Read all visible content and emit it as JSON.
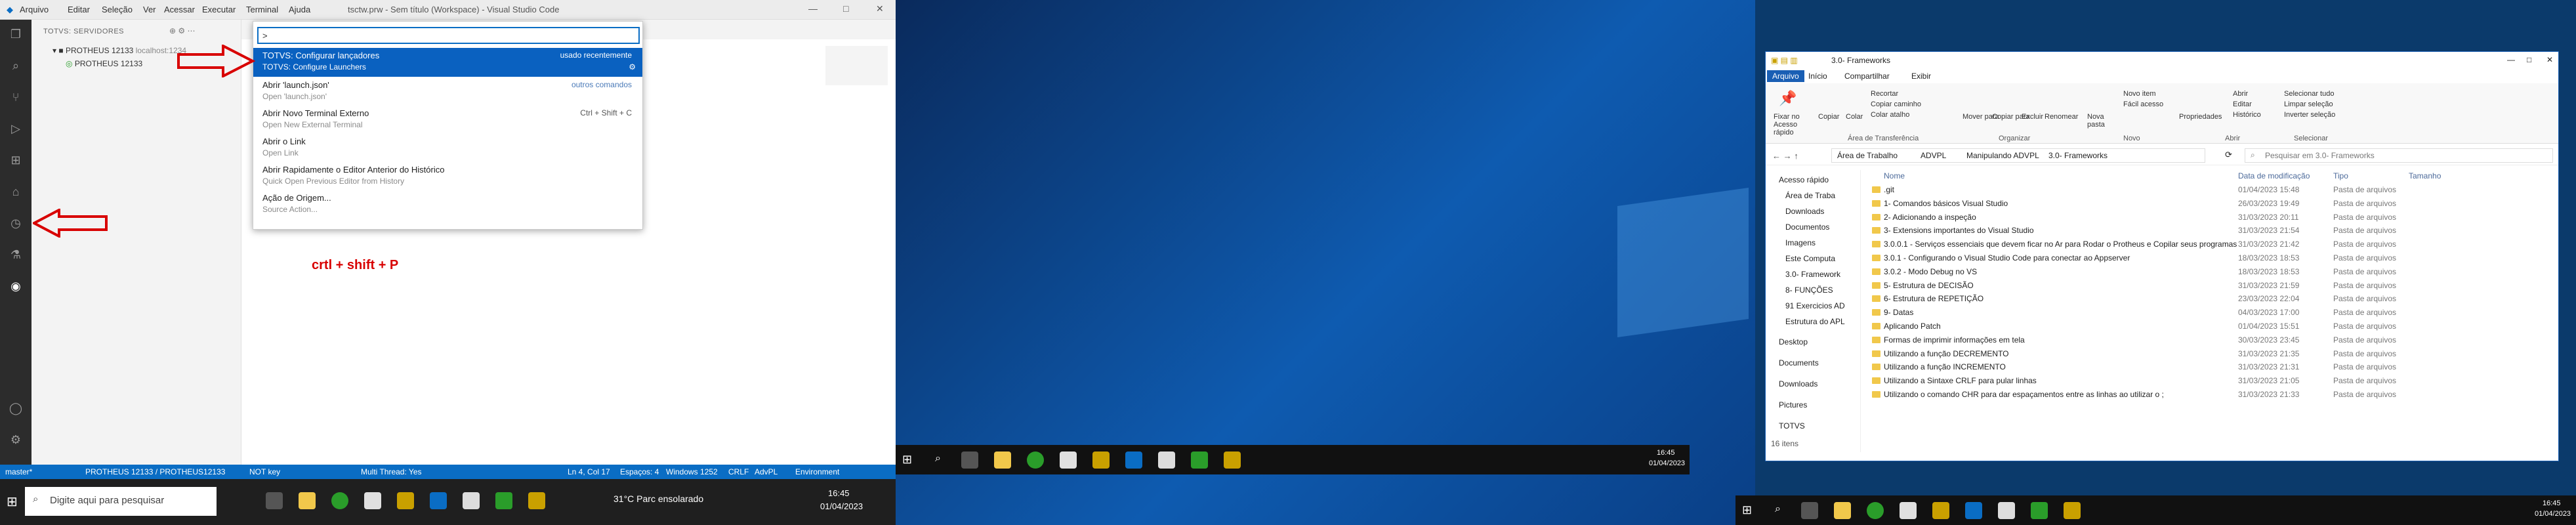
{
  "vscode": {
    "menu": [
      "Arquivo",
      "Editar",
      "Seleção",
      "Ver",
      "Acessar",
      "Executar",
      "Terminal",
      "Ajuda"
    ],
    "title": "tsctw.prw - Sem título (Workspace) - Visual Studio Code",
    "sidebar_header": "TOTVS: SERVIDORES",
    "server_name": "PROTHEUS 12133",
    "server_host": "localhost:1234",
    "server_child": "PROTHEUS 12133",
    "palette": {
      "input": ">",
      "items": [
        {
          "title": "TOTVS: Configurar lançadores",
          "subtitle": "TOTVS: Configure Launchers",
          "right": "usado recentemente"
        },
        {
          "title": "Abrir 'launch.json'",
          "subtitle": "Open 'launch.json'",
          "right": "outros comandos"
        },
        {
          "title": "Abrir Novo Terminal Externo",
          "subtitle": "Open New External Terminal",
          "right": "Ctrl + Shift + C"
        },
        {
          "title": "Abrir o Link",
          "subtitle": "Open Link",
          "right": ""
        },
        {
          "title": "Abrir Rapidamente o Editor Anterior do Histórico",
          "subtitle": "Quick Open Previous Editor from History",
          "right": ""
        },
        {
          "title": "Ação de Origem...",
          "subtitle": "Source Action...",
          "right": ""
        }
      ]
    },
    "shortcut_note": "crtl + shift + P",
    "status": {
      "branch": "master*",
      "server": "PROTHEUS 12133 / PROTHEUS12133",
      "key": "NOT key",
      "thread": "Multi Thread: Yes",
      "position": "Ln 4, Col 17",
      "spaces": "Espaços: 4",
      "encoding": "Windows 1252",
      "eol": "CRLF",
      "lang": "AdvPL",
      "env": "Environment"
    }
  },
  "taskbar_left": {
    "search_placeholder": "Digite aqui para pesquisar",
    "weather": "31°C  Parc ensolarado",
    "time": "16:45",
    "date": "01/04/2023"
  },
  "taskbar_middle": {
    "time": "16:45",
    "date": "01/04/2023"
  },
  "taskbar_right": {
    "time": "16:45",
    "date": "01/04/2023"
  },
  "explorer": {
    "title": "3.0- Frameworks",
    "tabs": [
      "Arquivo",
      "Início",
      "Compartilhar",
      "Exibir"
    ],
    "ribbon": {
      "pin": "Fixar no Acesso rápido",
      "copy": "Copiar",
      "paste": "Colar",
      "cut": "Recortar",
      "copy_path": "Copiar caminho",
      "paste_shortcut": "Colar atalho",
      "move": "Mover para",
      "copyto": "Copiar para",
      "delete": "Excluir",
      "rename": "Renomear",
      "newfolder": "Nova pasta",
      "newitem": "Novo item",
      "easyaccess": "Fácil acesso",
      "properties": "Propriedades",
      "open": "Abrir",
      "edit": "Editar",
      "history": "Histórico",
      "selectall": "Selecionar tudo",
      "clearsel": "Limpar seleção",
      "invertsel": "Inverter seleção",
      "groups": [
        "Área de Transferência",
        "Organizar",
        "Novo",
        "Abrir",
        "Selecionar"
      ]
    },
    "address": [
      "Área de Trabalho",
      "ADVPL",
      "Manipulando ADVPL",
      "3.0- Frameworks"
    ],
    "search_placeholder": "Pesquisar em 3.0- Frameworks",
    "nav": [
      "Acesso rápido",
      "Área de Traba",
      "Downloads",
      "Documentos",
      "Imagens",
      "Este Computa",
      "3.0- Framework",
      "8- FUNÇÕES",
      "91 Exercicios AD",
      "Estrutura do APL",
      "Desktop",
      "Documents",
      "Downloads",
      "Pictures",
      "TOTVS"
    ],
    "columns": [
      "Nome",
      "Data de modificação",
      "Tipo",
      "Tamanho"
    ],
    "rows": [
      {
        "name": ".git",
        "date": "01/04/2023 15:48",
        "type": "Pasta de arquivos"
      },
      {
        "name": "1- Comandos básicos Visual Studio",
        "date": "26/03/2023 19:49",
        "type": "Pasta de arquivos"
      },
      {
        "name": "2- Adicionando a inspeção",
        "date": "31/03/2023 20:11",
        "type": "Pasta de arquivos"
      },
      {
        "name": "3- Extensions importantes do Visual Studio",
        "date": "31/03/2023 21:54",
        "type": "Pasta de arquivos"
      },
      {
        "name": "3.0.0.1 - Serviços essenciais que devem ficar no Ar para Rodar o Protheus e Copilar seus programas",
        "date": "31/03/2023 21:42",
        "type": "Pasta de arquivos"
      },
      {
        "name": "3.0.1 - Configurando o Visual Studio Code para conectar ao Appserver",
        "date": "18/03/2023 18:53",
        "type": "Pasta de arquivos"
      },
      {
        "name": "3.0.2 - Modo Debug no VS",
        "date": "18/03/2023 18:53",
        "type": "Pasta de arquivos"
      },
      {
        "name": "5- Estrutura de DECISÃO",
        "date": "31/03/2023 21:59",
        "type": "Pasta de arquivos"
      },
      {
        "name": "6- Estrutura de REPETIÇÃO",
        "date": "23/03/2023 22:04",
        "type": "Pasta de arquivos"
      },
      {
        "name": "9- Datas",
        "date": "04/03/2023 17:00",
        "type": "Pasta de arquivos"
      },
      {
        "name": "Aplicando Patch",
        "date": "01/04/2023 15:51",
        "type": "Pasta de arquivos"
      },
      {
        "name": "Formas de imprimir informações em tela",
        "date": "30/03/2023 23:45",
        "type": "Pasta de arquivos"
      },
      {
        "name": "Utilizando a função DECREMENTO",
        "date": "31/03/2023 21:35",
        "type": "Pasta de arquivos"
      },
      {
        "name": "Utilizando a função INCREMENTO",
        "date": "31/03/2023 21:31",
        "type": "Pasta de arquivos"
      },
      {
        "name": "Utilizando a Sintaxe CRLF para pular linhas",
        "date": "31/03/2023 21:05",
        "type": "Pasta de arquivos"
      },
      {
        "name": "Utilizando o comando CHR para dar espaçamentos entre as linhas ao utilizar o ;",
        "date": "31/03/2023 21:33",
        "type": "Pasta de arquivos"
      }
    ],
    "item_count": "16 itens"
  },
  "colors": {
    "accent": "#0a6dc4",
    "arrow": "#d80000"
  }
}
